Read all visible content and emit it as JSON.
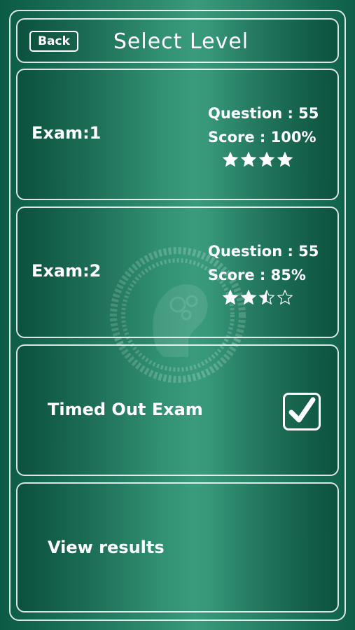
{
  "header": {
    "back_label": "Back",
    "title": "Select Level"
  },
  "exams": [
    {
      "label": "Exam:1",
      "question": "Question : 55",
      "score": "Score : 100%",
      "rating": 4,
      "max_rating": 4
    },
    {
      "label": "Exam:2",
      "question": "Question : 55",
      "score": "Score : 85%",
      "rating": 2.5,
      "max_rating": 4
    }
  ],
  "timed_out": {
    "label": "Timed Out Exam",
    "checked": true
  },
  "view_results": {
    "label": "View results"
  },
  "colors": {
    "accent": "#2f8c6f",
    "dark": "#0b5a45",
    "text": "#ffffff"
  },
  "icons": {
    "watermark": "brain-gears-icon",
    "star": "star-icon",
    "check": "checkmark-icon"
  }
}
